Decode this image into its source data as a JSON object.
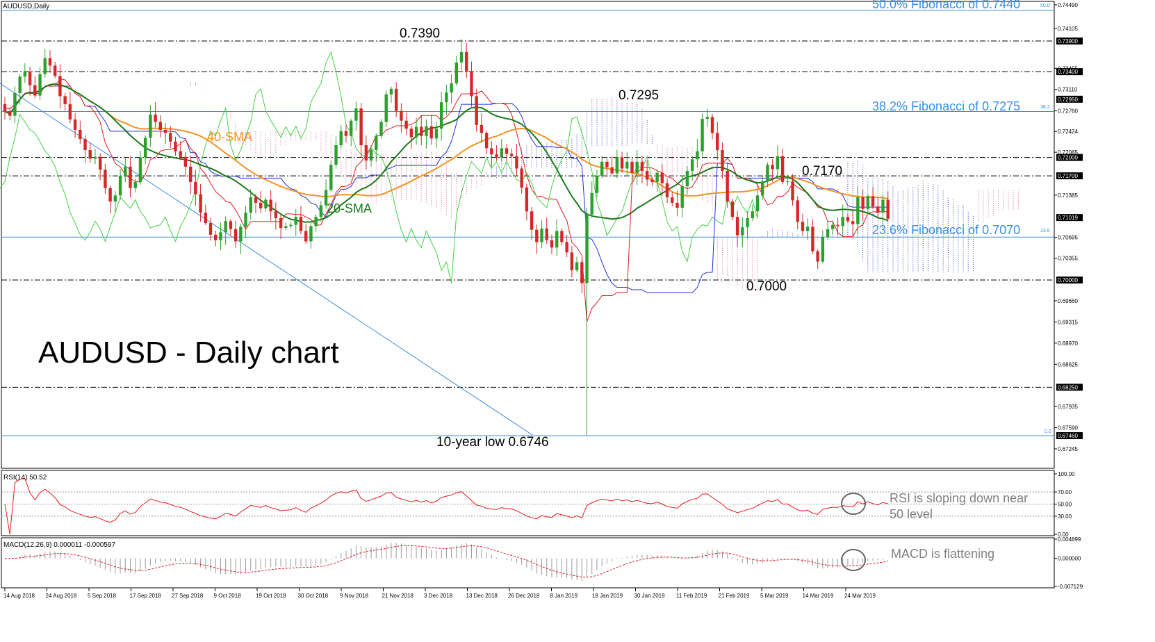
{
  "window": {
    "title": "AUDUSD,Daily"
  },
  "headline": "AUDUSD - Daily chart",
  "colors": {
    "bull": "#2ca02c",
    "bear": "#d62728",
    "sma20": "#1a7a1a",
    "sma40": "#f39222",
    "kijun": "#1f2fd6",
    "tenkan": "#e41a1c",
    "chikou": "#44d144",
    "fib": "#3a8fe0",
    "rsi": "#e41a1c",
    "macd": "#e41a1c",
    "hist": "#9a9a9a"
  },
  "annotations": {
    "high_1": "0.7390",
    "high_2": "0.7295",
    "high_3": "0.7170",
    "low_1": "0.7000",
    "low_2": "10-year low 0.6746",
    "sma40_label": "40-SMA",
    "sma20_label": "20-SMA",
    "fib_50": "50.0% Fibonacci of 0.7440",
    "fib_382": "38.2% Fibonacci of 0.7275",
    "fib_236": "23.6% Fibonacci of 0.7070",
    "fib_50_tag": "50.0",
    "fib_382_tag": "38.2",
    "fib_236_tag": "23.6",
    "fib_0_tag": "0.0",
    "rsi_note_1": "RSI is sloping down near",
    "rsi_note_2": "50 level",
    "macd_note": "MACD is flattening"
  },
  "rsi_panel": {
    "title": "RSI(14) 50.52",
    "ticks": [
      "100.00",
      "70.00",
      "50.00",
      "30.00",
      "0.00"
    ]
  },
  "macd_panel": {
    "title": "MACD(12,26,9) 0.000011 -0.000597",
    "ticks": [
      "0.004899",
      "0.000000",
      "-0.007129"
    ]
  },
  "chart_data": {
    "type": "candlestick",
    "title": "AUDUSD - Daily chart",
    "instrument": "AUDUSD, Daily",
    "y_ticks": [
      "0.74490",
      "0.74105",
      "0.73455",
      "0.73110",
      "0.72760",
      "0.72424",
      "0.72085",
      "0.71385",
      "0.70695",
      "0.70355",
      "0.69660",
      "0.69315",
      "0.68970",
      "0.68625",
      "0.67935",
      "0.67590",
      "0.67245"
    ],
    "y_highlight_ticks": [
      "0.73900",
      "0.73400",
      "0.72950",
      "0.72000",
      "0.71700",
      "0.71019",
      "0.70000",
      "0.68250",
      "0.67460"
    ],
    "x_labels": [
      "14 Aug 2018",
      "24 Aug 2018",
      "5 Sep 2018",
      "17 Sep 2018",
      "27 Sep 2018",
      "9 Oct 2018",
      "19 Oct 2018",
      "30 Oct 2018",
      "9 Nov 2018",
      "21 Nov 2018",
      "3 Dec 2018",
      "13 Dec 2018",
      "26 Dec 2018",
      "8 Jan 2019",
      "18 Jan 2019",
      "30 Jan 2019",
      "11 Feb 2019",
      "21 Feb 2019",
      "5 Mar 2019",
      "14 Mar 2019",
      "24 Mar 2019"
    ],
    "horizontal_levels": [
      0.739,
      0.734,
      0.72,
      0.717,
      0.7,
      0.6825,
      0.6746
    ],
    "fibonacci_levels": [
      {
        "label": "50.0%",
        "value": 0.744
      },
      {
        "label": "38.2%",
        "value": 0.7275
      },
      {
        "label": "23.6%",
        "value": 0.707
      },
      {
        "label": "0.0%",
        "value": 0.6746
      }
    ],
    "close": [
      0.7275,
      0.7268,
      0.7305,
      0.7332,
      0.734,
      0.7318,
      0.7301,
      0.7336,
      0.7362,
      0.735,
      0.7333,
      0.73,
      0.7287,
      0.7262,
      0.7245,
      0.723,
      0.7212,
      0.7198,
      0.7201,
      0.718,
      0.715,
      0.7128,
      0.7138,
      0.717,
      0.7185,
      0.715,
      0.716,
      0.72,
      0.7232,
      0.727,
      0.7258,
      0.7245,
      0.724,
      0.7226,
      0.721,
      0.7201,
      0.7185,
      0.716,
      0.714,
      0.711,
      0.7093,
      0.7074,
      0.7065,
      0.7078,
      0.7096,
      0.7083,
      0.7063,
      0.7087,
      0.711,
      0.7135,
      0.7126,
      0.7117,
      0.7131,
      0.7112,
      0.7101,
      0.7085,
      0.7088,
      0.709,
      0.7103,
      0.708,
      0.7063,
      0.7088,
      0.7103,
      0.7122,
      0.7147,
      0.7188,
      0.722,
      0.7243,
      0.7235,
      0.726,
      0.728,
      0.722,
      0.7195,
      0.7212,
      0.7235,
      0.7258,
      0.7303,
      0.7312,
      0.7276,
      0.726,
      0.7247,
      0.7233,
      0.725,
      0.7235,
      0.7251,
      0.7231,
      0.7247,
      0.729,
      0.7306,
      0.7321,
      0.7355,
      0.7372,
      0.734,
      0.73,
      0.7253,
      0.724,
      0.7215,
      0.7205,
      0.72,
      0.7215,
      0.7206,
      0.7202,
      0.7182,
      0.7151,
      0.7112,
      0.7082,
      0.7062,
      0.7084,
      0.7065,
      0.7053,
      0.708,
      0.7062,
      0.7045,
      0.7016,
      0.7029,
      0.6995,
      0.7107,
      0.7142,
      0.717,
      0.7193,
      0.7184,
      0.7174,
      0.72,
      0.7182,
      0.7193,
      0.7175,
      0.7193,
      0.7178,
      0.7164,
      0.716,
      0.7175,
      0.7158,
      0.7135,
      0.7126,
      0.7118,
      0.7153,
      0.7178,
      0.7197,
      0.721,
      0.7263,
      0.7266,
      0.724,
      0.7212,
      0.7178,
      0.7128,
      0.7103,
      0.7073,
      0.7086,
      0.7101,
      0.7112,
      0.7138,
      0.7161,
      0.7188,
      0.7181,
      0.7202,
      0.716,
      0.7161,
      0.713,
      0.7095,
      0.708,
      0.7087,
      0.7047,
      0.703,
      0.707,
      0.7083,
      0.709,
      0.7088,
      0.7103,
      0.7096,
      0.7091,
      0.7135,
      0.7116,
      0.7137,
      0.712,
      0.711,
      0.7131,
      0.71
    ],
    "sma20_label": "20-SMA",
    "sma40_label": "40-SMA",
    "rsi": {
      "name": "RSI(14)",
      "last": 50.52,
      "ylim": [
        0,
        100
      ],
      "levels": [
        70,
        50,
        30
      ]
    },
    "macd": {
      "name": "MACD(12,26,9)",
      "main": 1.1e-05,
      "signal": -0.000597,
      "ylim": [
        -0.007129,
        0.004899
      ]
    }
  }
}
